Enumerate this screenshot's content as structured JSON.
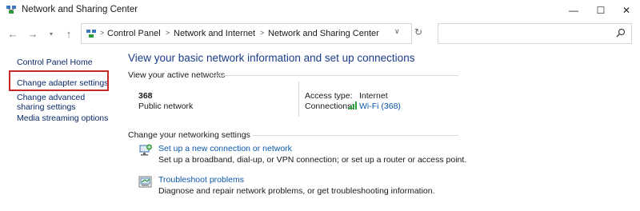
{
  "window": {
    "title": "Network and Sharing Center",
    "minimize_glyph": "—",
    "maximize_glyph": "☐",
    "close_glyph": "✕"
  },
  "nav": {
    "back_glyph": "←",
    "forward_glyph": "→",
    "recent_glyph": "▾",
    "up_glyph": "↑",
    "breadcrumbs": [
      "Control Panel",
      "Network and Internet",
      "Network and Sharing Center"
    ],
    "separator_glyph": ">",
    "dropdown_glyph": "∨",
    "refresh_glyph": "↻",
    "search_placeholder": ""
  },
  "sidebar": {
    "items": [
      {
        "label": "Control Panel Home"
      },
      {
        "label": "Change adapter settings"
      },
      {
        "label": "Change advanced sharing settings"
      },
      {
        "label": "Media streaming options"
      }
    ],
    "highlight_color": "#c62828"
  },
  "main": {
    "title": "View your basic network information and set up connections",
    "active_networks_heading": "View your active networks",
    "network": {
      "name": "368",
      "type": "Public network",
      "access_type_label": "Access type:",
      "access_type_value": "Internet",
      "connections_label": "Connections:",
      "connection_link": "Wi-Fi (368)"
    },
    "settings_heading": "Change your networking settings",
    "tasks": [
      {
        "icon": "new-connection-icon",
        "link": "Set up a new connection or network",
        "description": "Set up a broadband, dial-up, or VPN connection; or set up a router or access point."
      },
      {
        "icon": "troubleshoot-icon",
        "link": "Troubleshoot problems",
        "description": "Diagnose and repair network problems, or get troubleshooting information."
      }
    ]
  },
  "colors": {
    "title_blue": "#1b3c8a",
    "link_blue": "#0a58a8",
    "sidebar_link": "#0a2a6a"
  }
}
